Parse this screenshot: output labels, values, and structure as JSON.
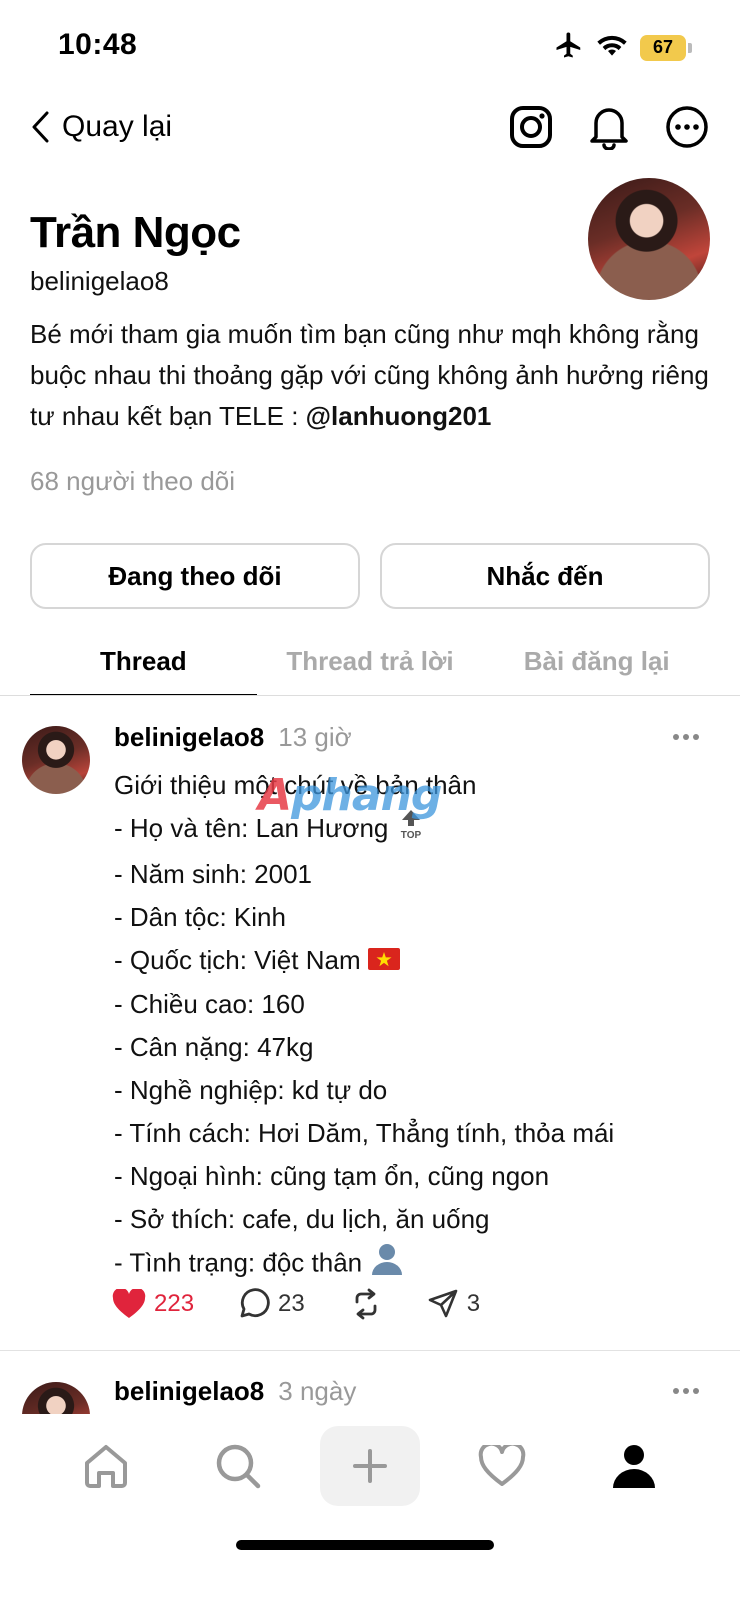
{
  "status_bar": {
    "time": "10:48",
    "battery": "67",
    "icons": [
      "airplane-icon",
      "wifi-icon",
      "battery-icon"
    ]
  },
  "nav": {
    "back_label": "Quay lại",
    "icons": [
      "instagram-icon",
      "bell-icon",
      "more-icon"
    ]
  },
  "profile": {
    "name": "Trần Ngọc",
    "handle": "belinigelao8",
    "bio_text": "Bé mới tham gia muốn tìm bạn cũng như mqh không rằng buộc nhau thi thoảng gặp với cũng không ảnh hưởng riêng tư nhau kết bạn TELE : ",
    "bio_handle": "@lanhuong201",
    "followers": "68 người theo dõi",
    "follow_button": "Đang theo dõi",
    "mention_button": "Nhắc đến"
  },
  "tabs": [
    "Thread",
    "Thread trả lời",
    "Bài đăng lại"
  ],
  "active_tab": "Thread",
  "post": {
    "user": "belinigelao8",
    "time": "13 giờ",
    "watermark": "Aphang",
    "lines": [
      "Giới thiệu một chút về bản thân",
      "- Họ và tên: Lan Hương",
      "- Năm sinh: 2001",
      "- Dân tộc: Kinh",
      "- Quốc tịch: Việt Nam",
      "- Chiều cao: 160",
      "- Cân nặng: 47kg",
      "- Nghề nghiệp: kd tự do",
      "- Tính cách: Hơi Dăm, Thẳng tính, thỏa mái",
      "- Ngoại hình: cũng tạm ổn, cũng ngon",
      "- Sở thích: cafe, du lịch, ăn uống",
      "- Tình trạng: độc thân"
    ],
    "top_badge": "TOP",
    "likes": "223",
    "comments": "23",
    "shares": "3",
    "like_color": "#e0243c"
  },
  "post2": {
    "user": "belinigelao8",
    "time": "3 ngày"
  },
  "bottom_nav": [
    "home-icon",
    "search-icon",
    "plus-icon",
    "heart-icon",
    "profile-icon"
  ]
}
